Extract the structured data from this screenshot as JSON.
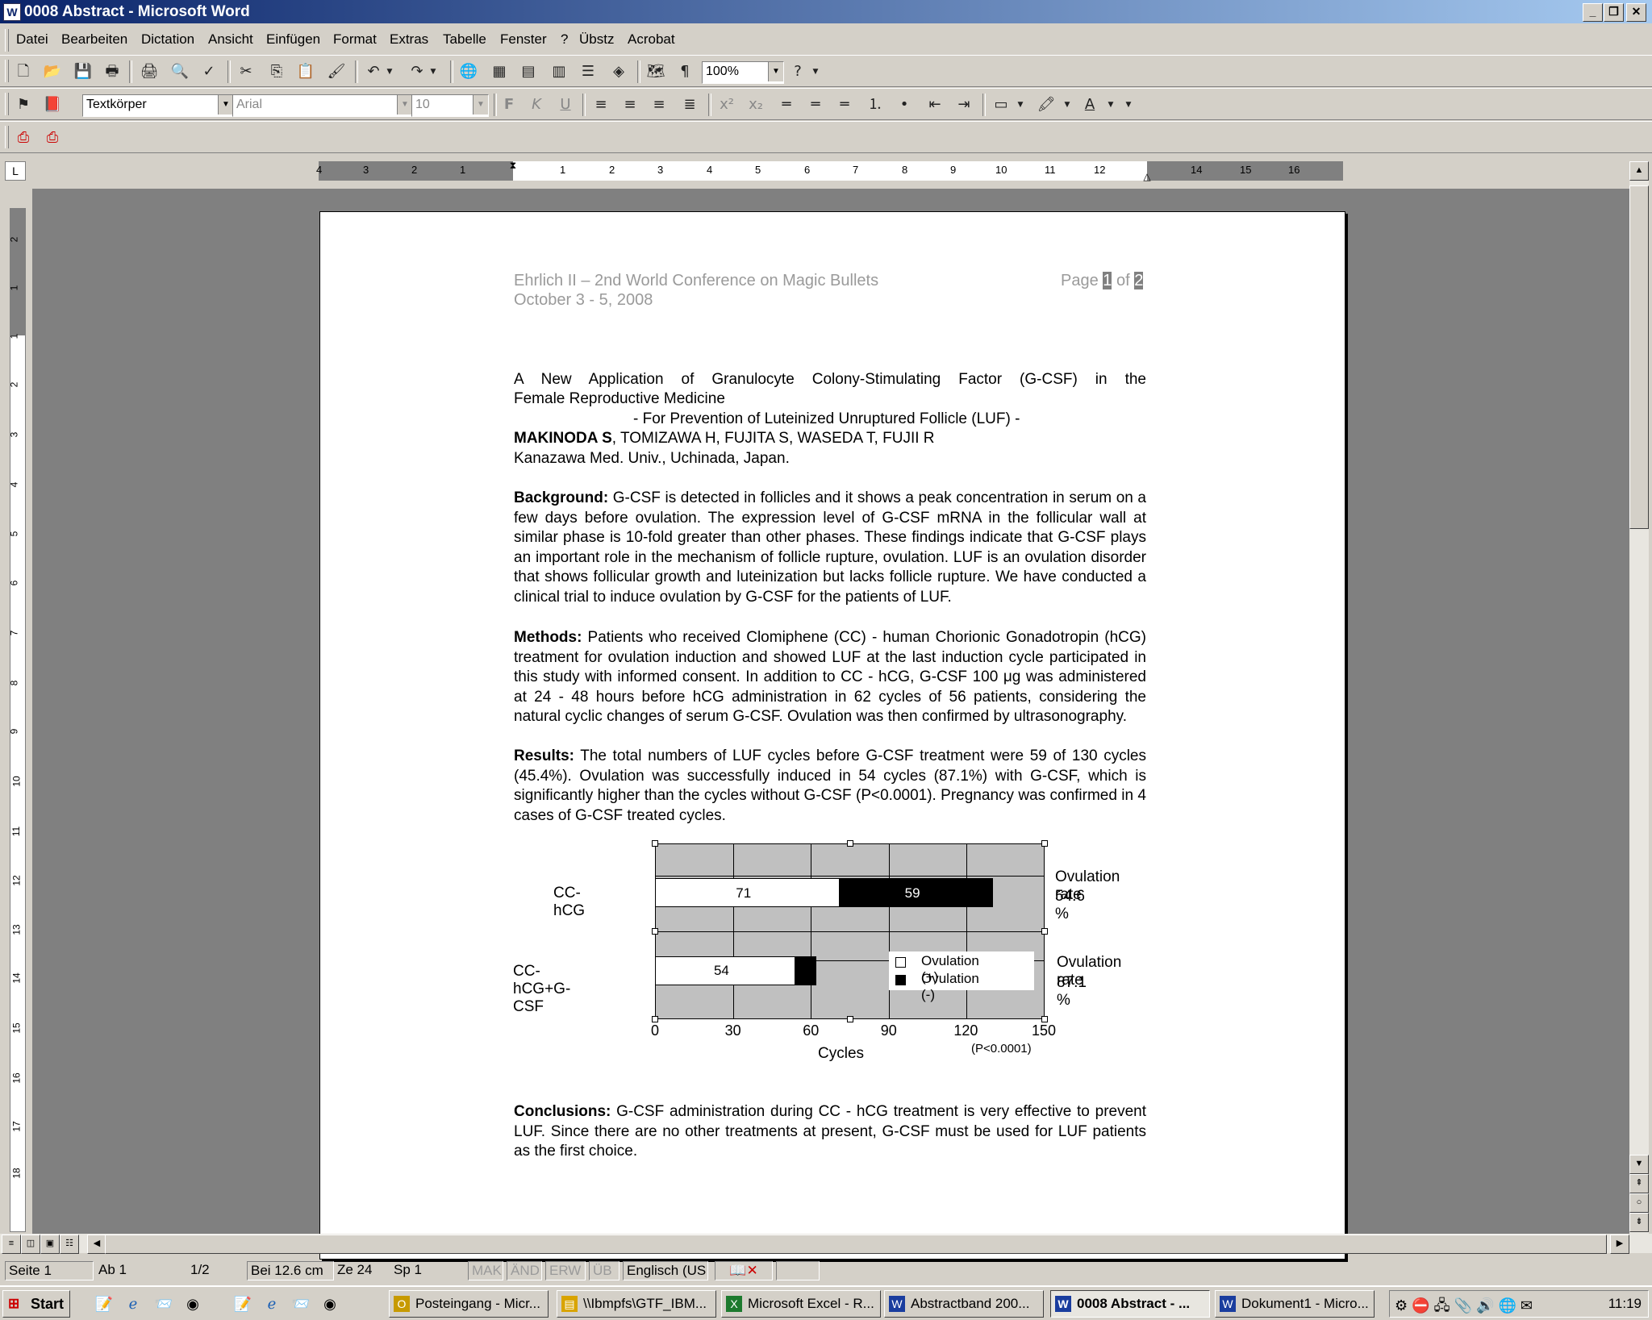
{
  "window": {
    "title": "0008 Abstract - Microsoft Word",
    "icon": "word-doc-icon",
    "controls": [
      "_",
      "🗗",
      "x"
    ]
  },
  "menu": [
    "Datei",
    "Bearbeiten",
    "Dictation",
    "Ansicht",
    "Einfügen",
    "Format",
    "Extras",
    "Tabelle",
    "Fenster",
    "?",
    "Übstz",
    "Acrobat"
  ],
  "toolbar": {
    "zoom": "100%",
    "style": "Textkörper",
    "font": "Arial",
    "size": "10"
  },
  "ruler": {
    "left_numbers": [
      "4",
      "3",
      "2",
      "1"
    ],
    "right_numbers": [
      "1",
      "2",
      "3",
      "4",
      "5",
      "6",
      "7",
      "8",
      "9",
      "10",
      "11",
      "12",
      "14",
      "15",
      "16"
    ],
    "vertical_numbers": [
      "2",
      "1",
      "1",
      "2",
      "3",
      "4",
      "5",
      "6",
      "7",
      "8",
      "9",
      "10",
      "11",
      "12",
      "13",
      "14",
      "15",
      "16",
      "17",
      "18"
    ]
  },
  "document": {
    "header_left_1": "Ehrlich II – 2nd World Conference on Magic Bullets",
    "header_left_2": "October 3 - 5, 2008",
    "header_page_prefix": "Page ",
    "header_page_num": "1",
    "header_page_mid": " of ",
    "header_page_total": "2",
    "title_1": "A New Application of Granulocyte Colony-Stimulating Factor (G-CSF) in the",
    "title_2": "Female Reproductive Medicine",
    "subtitle": "-  For Prevention of Luteinized Unruptured Follicle (LUF) -",
    "authors_bold": "MAKINODA S",
    "authors_rest": ", TOMIZAWA H, FUJITA S, WASEDA T, FUJII R",
    "affiliation": "Kanazawa Med. Univ., Uchinada, Japan.",
    "background_label": "Background:",
    "background_text": " G-CSF is detected in follicles and it shows a peak concentration in serum on a few days before ovulation.  The expression level of G-CSF mRNA in the follicular wall at similar phase is 10-fold greater than other phases.  These findings indicate that G-CSF plays an important role in the mechanism of follicle rupture, ovulation.  LUF is an ovulation disorder that shows follicular growth and luteinization but lacks follicle rupture.  We have conducted a clinical trial to induce ovulation by G-CSF for the patients of LUF.",
    "methods_label": "Methods:",
    "methods_text": " Patients who received Clomiphene (CC) - human Chorionic Gonadotropin (hCG) treatment for ovulation induction and showed LUF at the last induction cycle participated in this study with informed consent.  In addition to CC - hCG, G-CSF 100 μg was administered at 24 - 48 hours before hCG administration in 62 cycles of 56 patients, considering the natural cyclic changes of serum G-CSF.  Ovulation was then confirmed by ultrasonography.",
    "results_label": "Results:",
    "results_text": " The total numbers of LUF cycles before G-CSF treatment were 59 of 130 cycles (45.4%).  Ovulation was successfully induced in 54 cycles (87.1%) with G-CSF, which is significantly higher than the cycles without G-CSF (P<0.0001).  Pregnancy was confirmed in 4 cases of G-CSF treated cycles.",
    "conclusions_label": "Conclusions:",
    "conclusions_text": " G-CSF administration during CC - hCG treatment is very effective to prevent LUF.  Since there are no other treatments at present, G-CSF must be used for  LUF patients as the first choice."
  },
  "chart_data": {
    "type": "bar",
    "orientation": "horizontal",
    "stacked": true,
    "categories": [
      "CC-hCG",
      "CC-hCG+G-CSF"
    ],
    "series": [
      {
        "name": "Ovulation (+)",
        "values": [
          71,
          54
        ],
        "color": "#ffffff"
      },
      {
        "name": "Ovulation (-)",
        "values": [
          59,
          8
        ],
        "color": "#000000"
      }
    ],
    "data_labels": [
      "71",
      "59",
      "54"
    ],
    "xlabel": "Cycles",
    "xlim": [
      0,
      150
    ],
    "xticks": [
      0,
      30,
      60,
      90,
      120,
      150
    ],
    "grid": true,
    "legend_position": "inside bottom-right",
    "annotations": [
      {
        "text": "Ovulation rate",
        "value": "54.6 %"
      },
      {
        "text": "Ovulation rate",
        "value": "87.1 %"
      },
      {
        "text": "(P<0.0001)"
      }
    ]
  },
  "status": {
    "seite": "Seite 1",
    "ab": "Ab 1",
    "pages": "1/2",
    "bei": "Bei 12.6 cm",
    "ze": "Ze 24",
    "sp": "Sp 1",
    "mak": "MAK",
    "and": "ÄND",
    "erw": "ERW",
    "ub": "ÜB",
    "lang": "Englisch (US"
  },
  "taskbar": {
    "start": "Start",
    "tasks": [
      {
        "label": "Posteingang - Micr...",
        "icon": "outlook-icon",
        "active": false
      },
      {
        "label": "\\\\Ibmpfs\\GTF_IBM...",
        "icon": "folder-icon",
        "active": false
      },
      {
        "label": "Microsoft Excel - R...",
        "icon": "excel-icon",
        "active": false
      },
      {
        "label": "Abstractband 200...",
        "icon": "word-icon",
        "active": false
      },
      {
        "label": "0008 Abstract - ...",
        "icon": "word-icon",
        "active": true
      },
      {
        "label": "Dokument1 - Micro...",
        "icon": "word-icon",
        "active": false
      }
    ],
    "clock": "11:19"
  }
}
